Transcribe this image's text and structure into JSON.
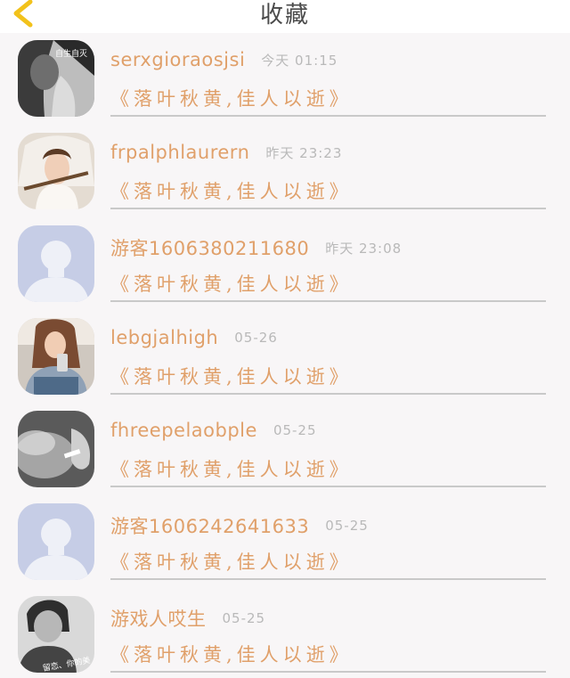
{
  "header": {
    "title": "收藏",
    "back_icon": "chevron-left-icon",
    "back_color": "#f2c21b"
  },
  "colors": {
    "accent": "#e0a06a",
    "muted": "#b9b9b9",
    "divider": "#c9c9c9"
  },
  "items": [
    {
      "username": "serxgioraosjsi",
      "time": "今天  01:15",
      "title": "《落叶秋黄,佳人以逝》",
      "avatar": "avatar-girl-bw",
      "avatar_text": "自生自灭"
    },
    {
      "username": "frpalphlaurern",
      "time": "昨天  23:23",
      "title": "《落叶秋黄,佳人以逝》",
      "avatar": "avatar-girl-veil"
    },
    {
      "username": "游客1606380211680",
      "time": "昨天  23:08",
      "title": "《落叶秋黄,佳人以逝》",
      "avatar": "avatar-default"
    },
    {
      "username": "lebgjalhigh",
      "time": "05-26",
      "title": "《落叶秋黄,佳人以逝》",
      "avatar": "avatar-girl-phone"
    },
    {
      "username": "fhreepelaobple",
      "time": "05-25",
      "title": "《落叶秋黄,佳人以逝》",
      "avatar": "avatar-smoke"
    },
    {
      "username": "游客1606242641633",
      "time": "05-25",
      "title": "《落叶秋黄,佳人以逝》",
      "avatar": "avatar-default"
    },
    {
      "username": "游戏人哎生",
      "time": "05-25",
      "title": "《落叶秋黄,佳人以逝》",
      "avatar": "avatar-boy-bw",
      "avatar_text": "留恋、你的美"
    }
  ]
}
